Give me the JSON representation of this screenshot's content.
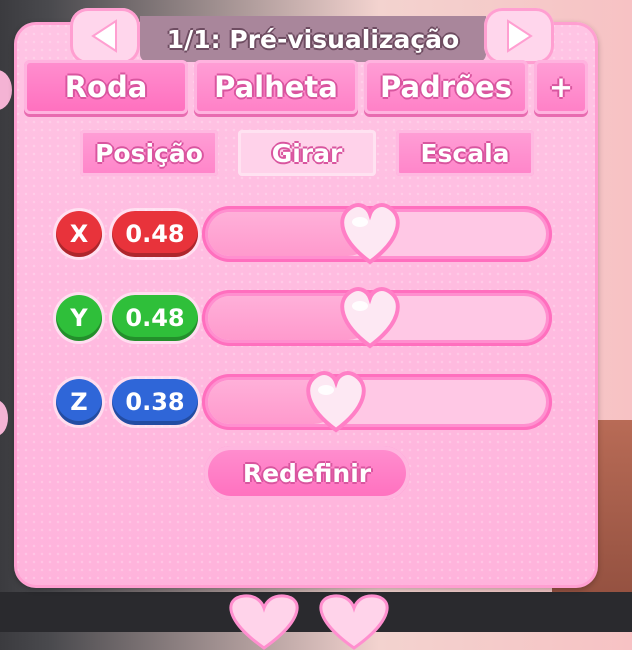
{
  "header": {
    "title": "1/1: Pré-visualização",
    "prev_icon": "triangle-left-icon",
    "next_icon": "triangle-right-icon"
  },
  "tabs": [
    {
      "label": "Roda",
      "active": true
    },
    {
      "label": "Palheta",
      "active": false
    },
    {
      "label": "Padrões",
      "active": false
    },
    {
      "label": "+",
      "active": false
    }
  ],
  "modes": [
    {
      "label": "Posição",
      "active": false
    },
    {
      "label": "Girar",
      "active": true
    },
    {
      "label": "Escala",
      "active": false
    }
  ],
  "sliders": [
    {
      "axis": "X",
      "value_text": "0.48",
      "value": 0.48,
      "color": "#e8333b",
      "thumb_icon": "heart-icon"
    },
    {
      "axis": "Y",
      "value_text": "0.48",
      "value": 0.48,
      "color": "#2fbf3a",
      "thumb_icon": "heart-icon"
    },
    {
      "axis": "Z",
      "value_text": "0.38",
      "value": 0.38,
      "color": "#2f66d8",
      "thumb_icon": "heart-icon"
    }
  ],
  "reset_button": {
    "label": "Redefinir"
  },
  "colors": {
    "panel": "#ffb3dc",
    "accent": "#ff7fc6",
    "title_bar": "#a9869b"
  }
}
